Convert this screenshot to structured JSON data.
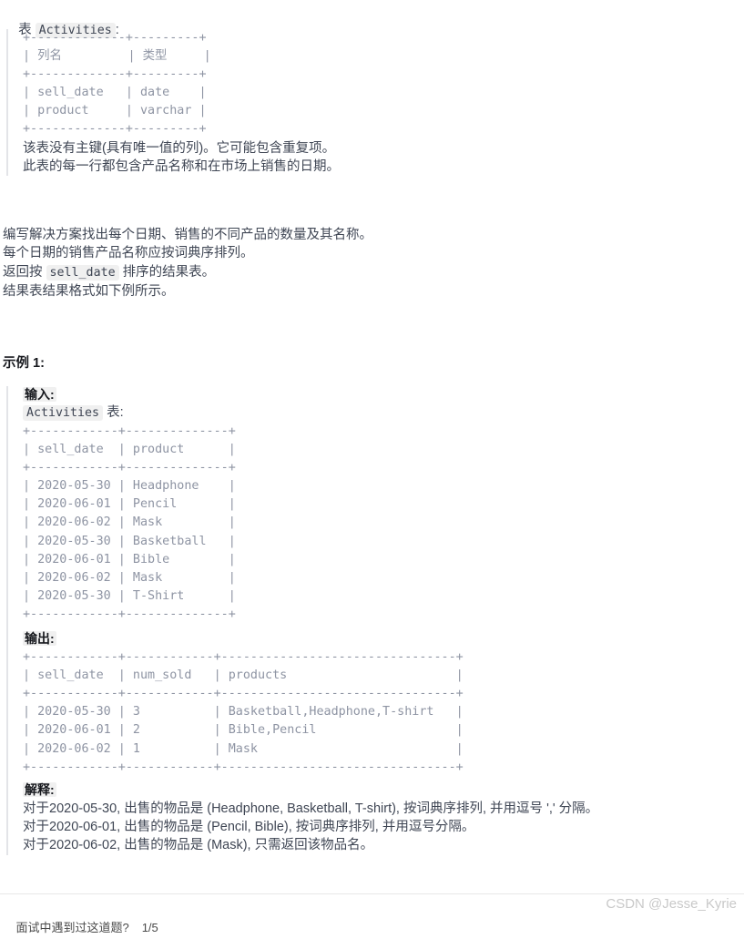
{
  "schema_section": {
    "prefix": "表 ",
    "table_name": "Activities",
    "suffix": ":",
    "schema_table": "+-------------+---------+\n| 列名         | 类型     |\n+-------------+---------+\n| sell_date   | date    |\n| product     | varchar |\n+-------------+---------+",
    "note_line1": "该表没有主键(具有唯一值的列)。它可能包含重复项。",
    "note_line2": "此表的每一行都包含产品名称和在市场上销售的日期。"
  },
  "description": {
    "line1": "编写解决方案找出每个日期、销售的不同产品的数量及其名称。",
    "line2": "每个日期的销售产品名称应按词典序排列。",
    "line3_prefix": "返回按 ",
    "line3_code": "sell_date",
    "line3_suffix": " 排序的结果表。",
    "line4": "结果表结果格式如下例所示。"
  },
  "example": {
    "heading": "示例 1:",
    "input_label": "输入:",
    "input_table_name": "Activities",
    "input_table_suffix": " 表:",
    "input_table": "+------------+--------------+\n| sell_date  | product      |\n+------------+--------------+\n| 2020-05-30 | Headphone    |\n| 2020-06-01 | Pencil       |\n| 2020-06-02 | Mask         |\n| 2020-05-30 | Basketball   |\n| 2020-06-01 | Bible        |\n| 2020-06-02 | Mask         |\n| 2020-05-30 | T-Shirt      |\n+------------+--------------+",
    "output_label": "输出:",
    "output_table": "+------------+------------+--------------------------------+\n| sell_date  | num_sold   | products                       |\n+------------+------------+--------------------------------+\n| 2020-05-30 | 3          | Basketball,Headphone,T-shirt   |\n| 2020-06-01 | 2          | Bible,Pencil                   |\n| 2020-06-02 | 1          | Mask                           |\n+------------+------------+--------------------------------+",
    "explanation_label": "解释:",
    "explanation_line1": "对于2020-05-30, 出售的物品是 (Headphone, Basketball, T-shirt), 按词典序排列, 并用逗号 ',' 分隔。",
    "explanation_line2": "对于2020-06-01, 出售的物品是 (Pencil, Bible), 按词典序排列, 并用逗号分隔。",
    "explanation_line3": "对于2020-06-02, 出售的物品是 (Mask), 只需返回该物品名。"
  },
  "footer": {
    "question_text": "面试中遇到过这道题?",
    "counter": "1/5",
    "watermark": "CSDN @Jesse_Kyrie"
  },
  "colors": {
    "body_text": "#3f4654",
    "code_text": "#8e94a3",
    "heading_text": "#16181d",
    "chip_bg": "#f0f0f0",
    "quote_border": "#e3e4e8",
    "watermark": "#c9c9c9",
    "divider": "#e8e8e8"
  }
}
